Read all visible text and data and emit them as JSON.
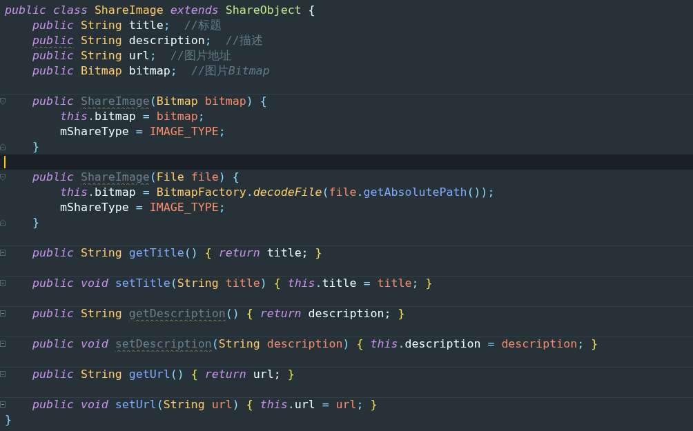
{
  "editor": {
    "lines": [
      {
        "kind": "plain",
        "current": false,
        "separator_above": false,
        "tokens": [
          {
            "kind": "keyword",
            "text": "public class "
          },
          {
            "kind": "type",
            "text": "ShareImage "
          },
          {
            "kind": "keyword",
            "text": "extends "
          },
          {
            "kind": "supertype",
            "text": "ShareObject "
          },
          {
            "kind": "plain",
            "text": "{"
          }
        ],
        "children": [
          {
            "kind": "plain",
            "current": false,
            "separator_above": false,
            "tokens": [
              {
                "kind": "keyword",
                "text": "public "
              },
              {
                "kind": "type",
                "text": "String "
              },
              {
                "kind": "plain",
                "text": "title"
              },
              {
                "kind": "punct",
                "text": ";  "
              },
              {
                "kind": "comment",
                "text": "//标题"
              }
            ]
          },
          {
            "kind": "plain",
            "current": false,
            "separator_above": false,
            "tokens": [
              {
                "kind": "warnkeyword",
                "text": "public"
              },
              {
                "kind": "type",
                "text": " String "
              },
              {
                "kind": "plain",
                "text": "description"
              },
              {
                "kind": "punct",
                "text": ";  "
              },
              {
                "kind": "comment",
                "text": "//描述"
              }
            ]
          },
          {
            "kind": "plain",
            "current": false,
            "separator_above": false,
            "tokens": [
              {
                "kind": "keyword",
                "text": "public "
              },
              {
                "kind": "type",
                "text": "String "
              },
              {
                "kind": "plain",
                "text": "url"
              },
              {
                "kind": "punct",
                "text": ";  "
              },
              {
                "kind": "comment",
                "text": "//图片地址"
              }
            ]
          },
          {
            "kind": "plain",
            "current": false,
            "separator_above": false,
            "tokens": [
              {
                "kind": "keyword",
                "text": "public "
              },
              {
                "kind": "type",
                "text": "Bitmap "
              },
              {
                "kind": "plain",
                "text": "bitmap"
              },
              {
                "kind": "punct",
                "text": ";  "
              },
              {
                "kind": "comment",
                "text": "//图片"
              },
              {
                "kind": "commentitalic",
                "text": "Bitmap"
              }
            ]
          },
          {
            "kind": "plain",
            "current": false,
            "separator_above": false
          },
          {
            "kind": "fold_start",
            "current": false,
            "separator_above": true,
            "tokens": [
              {
                "kind": "keyword",
                "text": "public "
              },
              {
                "kind": "unused",
                "text": "ShareImage"
              },
              {
                "kind": "punct",
                "text": "("
              },
              {
                "kind": "type",
                "text": "Bitmap "
              },
              {
                "kind": "param",
                "text": "bitmap"
              },
              {
                "kind": "punct",
                "text": ") {"
              }
            ],
            "children": [
              {
                "kind": "plain",
                "current": false,
                "separator_above": false,
                "tokens": [
                  {
                    "kind": "keyword",
                    "text": "this"
                  },
                  {
                    "kind": "punct",
                    "text": "."
                  },
                  {
                    "kind": "plain",
                    "text": "bitmap "
                  },
                  {
                    "kind": "punct",
                    "text": "= "
                  },
                  {
                    "kind": "param",
                    "text": "bitmap"
                  },
                  {
                    "kind": "punct",
                    "text": ";"
                  }
                ]
              },
              {
                "kind": "plain",
                "current": false,
                "separator_above": false,
                "tokens": [
                  {
                    "kind": "plain",
                    "text": "mShareType "
                  },
                  {
                    "kind": "punct",
                    "text": "= "
                  },
                  {
                    "kind": "param",
                    "text": "IMAGE_TYPE"
                  },
                  {
                    "kind": "punct",
                    "text": ";"
                  }
                ]
              }
            ]
          },
          {
            "kind": "fold_end",
            "current": false,
            "separator_above": false,
            "tokens": [
              {
                "kind": "punct",
                "text": "}"
              }
            ]
          },
          {
            "kind": "plain",
            "current": true,
            "separator_above": false
          },
          {
            "kind": "fold_start",
            "current": false,
            "separator_above": false,
            "tokens": [
              {
                "kind": "keyword",
                "text": "public "
              },
              {
                "kind": "unused",
                "text": "ShareImage"
              },
              {
                "kind": "punct",
                "text": "("
              },
              {
                "kind": "type",
                "text": "File "
              },
              {
                "kind": "param",
                "text": "file"
              },
              {
                "kind": "punct",
                "text": ") {"
              }
            ],
            "children": [
              {
                "kind": "plain",
                "current": false,
                "separator_above": false,
                "tokens": [
                  {
                    "kind": "keyword",
                    "text": "this"
                  },
                  {
                    "kind": "punct",
                    "text": "."
                  },
                  {
                    "kind": "plain",
                    "text": "bitmap "
                  },
                  {
                    "kind": "punct",
                    "text": "= "
                  },
                  {
                    "kind": "type",
                    "text": "BitmapFactory"
                  },
                  {
                    "kind": "punct",
                    "text": "."
                  },
                  {
                    "kind": "static",
                    "text": "decodeFile"
                  },
                  {
                    "kind": "punct",
                    "text": "("
                  },
                  {
                    "kind": "param",
                    "text": "file"
                  },
                  {
                    "kind": "punct",
                    "text": "."
                  },
                  {
                    "kind": "method",
                    "text": "getAbsolutePath"
                  },
                  {
                    "kind": "punct",
                    "text": "());"
                  }
                ]
              },
              {
                "kind": "plain",
                "current": false,
                "separator_above": false,
                "tokens": [
                  {
                    "kind": "plain",
                    "text": "mShareType "
                  },
                  {
                    "kind": "punct",
                    "text": "= "
                  },
                  {
                    "kind": "param",
                    "text": "IMAGE_TYPE"
                  },
                  {
                    "kind": "punct",
                    "text": ";"
                  }
                ]
              }
            ]
          },
          {
            "kind": "fold_end",
            "current": false,
            "separator_above": false,
            "tokens": [
              {
                "kind": "punct",
                "text": "}"
              }
            ]
          },
          {
            "kind": "plain",
            "current": false,
            "separator_above": false
          },
          {
            "kind": "foldable",
            "current": false,
            "separator_above": true,
            "tokens": [
              {
                "kind": "keyword",
                "text": "public "
              },
              {
                "kind": "type",
                "text": "String "
              },
              {
                "kind": "method",
                "text": "getTitle"
              },
              {
                "kind": "punct",
                "text": "() "
              },
              {
                "kind": "brace",
                "text": "{ "
              },
              {
                "kind": "keyword",
                "text": "return "
              },
              {
                "kind": "plain",
                "text": "title; "
              },
              {
                "kind": "brace",
                "text": "}"
              }
            ]
          },
          {
            "kind": "plain",
            "current": false,
            "separator_above": false
          },
          {
            "kind": "foldable",
            "current": false,
            "separator_above": true,
            "tokens": [
              {
                "kind": "keyword",
                "text": "public void "
              },
              {
                "kind": "method",
                "text": "setTitle"
              },
              {
                "kind": "punct",
                "text": "("
              },
              {
                "kind": "type",
                "text": "String "
              },
              {
                "kind": "param",
                "text": "title"
              },
              {
                "kind": "punct",
                "text": ") "
              },
              {
                "kind": "brace",
                "text": "{ "
              },
              {
                "kind": "keyword",
                "text": "this"
              },
              {
                "kind": "punct",
                "text": "."
              },
              {
                "kind": "plain",
                "text": "title "
              },
              {
                "kind": "punct",
                "text": "= "
              },
              {
                "kind": "param",
                "text": "title"
              },
              {
                "kind": "punct",
                "text": "; "
              },
              {
                "kind": "brace",
                "text": "}"
              }
            ]
          },
          {
            "kind": "plain",
            "current": false,
            "separator_above": false
          },
          {
            "kind": "foldable",
            "current": false,
            "separator_above": true,
            "tokens": [
              {
                "kind": "keyword",
                "text": "public "
              },
              {
                "kind": "type",
                "text": "String "
              },
              {
                "kind": "unused",
                "text": "getDescription"
              },
              {
                "kind": "punct",
                "text": "() "
              },
              {
                "kind": "brace",
                "text": "{ "
              },
              {
                "kind": "keyword",
                "text": "return "
              },
              {
                "kind": "plain",
                "text": "description; "
              },
              {
                "kind": "brace",
                "text": "}"
              }
            ]
          },
          {
            "kind": "plain",
            "current": false,
            "separator_above": false
          },
          {
            "kind": "foldable",
            "current": false,
            "separator_above": true,
            "tokens": [
              {
                "kind": "keyword",
                "text": "public void "
              },
              {
                "kind": "unused",
                "text": "setDescription"
              },
              {
                "kind": "punct",
                "text": "("
              },
              {
                "kind": "type",
                "text": "String "
              },
              {
                "kind": "param",
                "text": "description"
              },
              {
                "kind": "punct",
                "text": ") "
              },
              {
                "kind": "brace",
                "text": "{ "
              },
              {
                "kind": "keyword",
                "text": "this"
              },
              {
                "kind": "punct",
                "text": "."
              },
              {
                "kind": "plain",
                "text": "description "
              },
              {
                "kind": "punct",
                "text": "= "
              },
              {
                "kind": "param",
                "text": "description"
              },
              {
                "kind": "punct",
                "text": "; "
              },
              {
                "kind": "brace",
                "text": "}"
              }
            ]
          },
          {
            "kind": "plain",
            "current": false,
            "separator_above": false
          },
          {
            "kind": "foldable",
            "current": false,
            "separator_above": true,
            "tokens": [
              {
                "kind": "keyword",
                "text": "public "
              },
              {
                "kind": "type",
                "text": "String "
              },
              {
                "kind": "method",
                "text": "getUrl"
              },
              {
                "kind": "punct",
                "text": "() "
              },
              {
                "kind": "brace",
                "text": "{ "
              },
              {
                "kind": "keyword",
                "text": "return "
              },
              {
                "kind": "plain",
                "text": "url; "
              },
              {
                "kind": "brace",
                "text": "}"
              }
            ]
          },
          {
            "kind": "plain",
            "current": false,
            "separator_above": false
          },
          {
            "kind": "foldable",
            "current": false,
            "separator_above": true,
            "tokens": [
              {
                "kind": "keyword",
                "text": "public void "
              },
              {
                "kind": "method",
                "text": "setUrl"
              },
              {
                "kind": "punct",
                "text": "("
              },
              {
                "kind": "type",
                "text": "String "
              },
              {
                "kind": "param",
                "text": "url"
              },
              {
                "kind": "punct",
                "text": ") "
              },
              {
                "kind": "brace",
                "text": "{ "
              },
              {
                "kind": "keyword",
                "text": "this"
              },
              {
                "kind": "punct",
                "text": "."
              },
              {
                "kind": "plain",
                "text": "url "
              },
              {
                "kind": "punct",
                "text": "= "
              },
              {
                "kind": "param",
                "text": "url"
              },
              {
                "kind": "punct",
                "text": "; "
              },
              {
                "kind": "brace",
                "text": "}"
              }
            ]
          }
        ]
      },
      {
        "kind": "plain",
        "current": false,
        "separator_above": false,
        "tokens": [
          {
            "kind": "punct",
            "text": "}"
          }
        ]
      }
    ]
  }
}
